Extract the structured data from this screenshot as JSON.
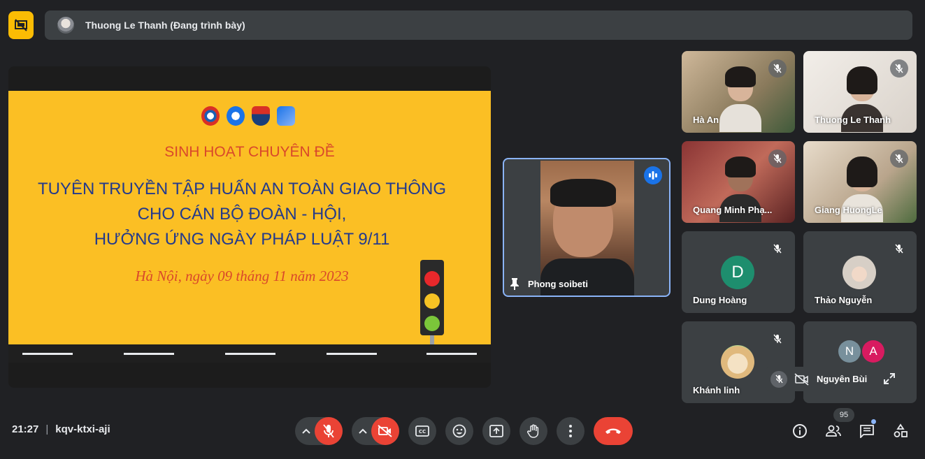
{
  "presenter": {
    "name": "Thuong Le Thanh (Đang trình bày)"
  },
  "slide": {
    "subtitle": "SINH HOẠT CHUYÊN ĐỀ",
    "title_line1": "TUYÊN TRUYỀN TẬP HUẤN AN TOÀN GIAO THÔNG",
    "title_line2": "CHO CÁN BỘ ĐOÀN - HỘI,",
    "title_line3": "HƯỞNG ỨNG NGÀY PHÁP LUẬT 9/11",
    "date": "Hà Nội, ngày 09 tháng 11 năm 2023"
  },
  "pinned": {
    "name": "Phong soibeti"
  },
  "participants": {
    "ha_an": "Hà An",
    "thuong": "Thuong Le Thanh",
    "quang": "Quang Minh Phạ...",
    "giang": "Giang HuongLe",
    "dung": "Dung Hoàng",
    "dung_initial": "D",
    "thao": "Thảo Nguyễn",
    "khanh": "Khánh linh",
    "others_initial_1": "N",
    "others_initial_2": "A"
  },
  "self": {
    "name": "Nguyên Bùi"
  },
  "meeting": {
    "time": "21:27",
    "separator": "|",
    "code": "kqv-ktxi-aji"
  },
  "people_count": "95",
  "colors": {
    "accent": "#8ab4f8",
    "danger": "#ea4335",
    "present": "#fbbc04",
    "slide_bg": "#fbbf24"
  }
}
